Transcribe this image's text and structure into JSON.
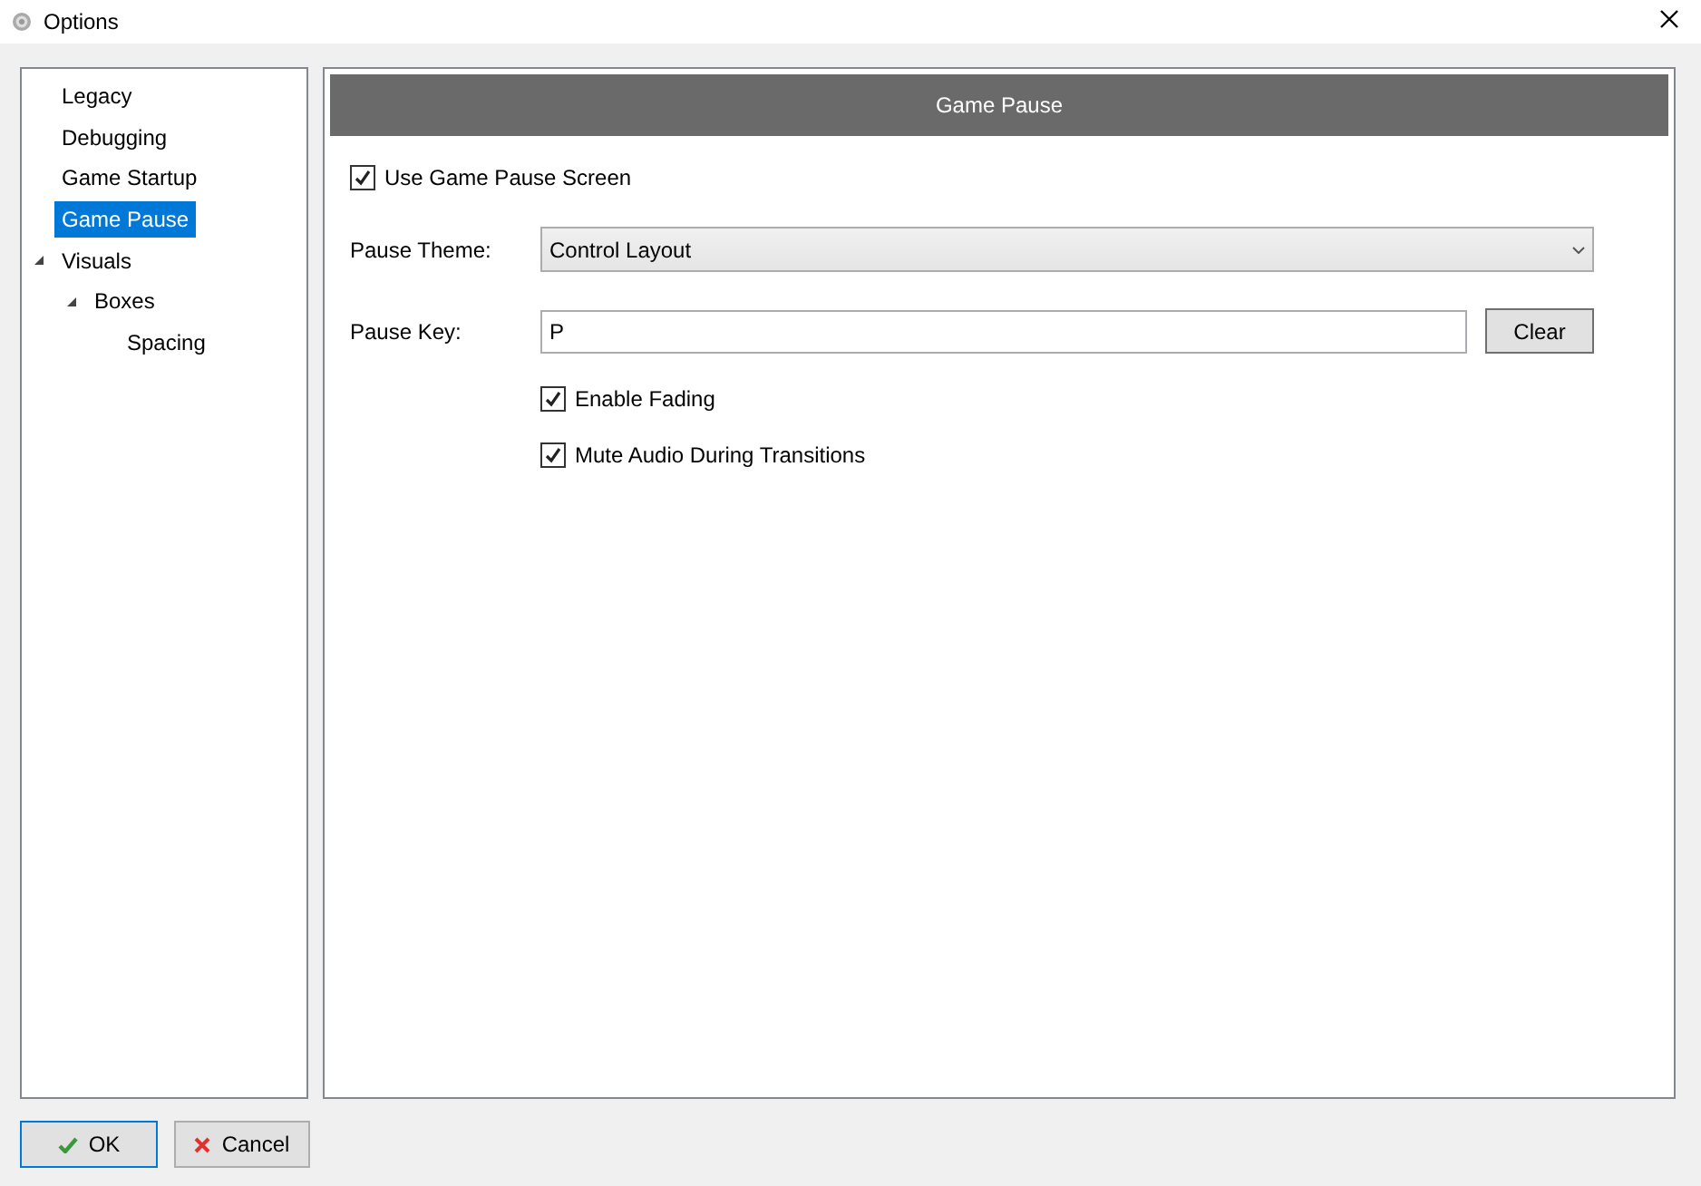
{
  "window": {
    "title": "Options"
  },
  "tree": [
    {
      "label": "Legacy",
      "selected": false
    },
    {
      "label": "Debugging",
      "selected": false
    },
    {
      "label": "Game Startup",
      "selected": false
    },
    {
      "label": "Game Pause",
      "selected": true
    },
    {
      "label": "Visuals",
      "selected": false,
      "expanded": true,
      "children": [
        {
          "label": "Boxes",
          "selected": false,
          "expanded": true,
          "children": [
            {
              "label": "Spacing",
              "selected": false
            }
          ]
        }
      ]
    }
  ],
  "panel": {
    "header": "Game Pause",
    "use_pause_screen": {
      "label": "Use Game Pause Screen",
      "checked": true
    },
    "theme": {
      "label": "Pause Theme:",
      "value": "Control Layout"
    },
    "key": {
      "label": "Pause Key:",
      "value": "P",
      "button": "Clear"
    },
    "options": [
      {
        "label": "Enable Fading",
        "checked": true
      },
      {
        "label": "Mute Audio During Transitions",
        "checked": true
      }
    ]
  },
  "buttons": [
    {
      "kind": "ok",
      "label": "OK"
    },
    {
      "kind": "cancel",
      "label": "Cancel"
    }
  ]
}
